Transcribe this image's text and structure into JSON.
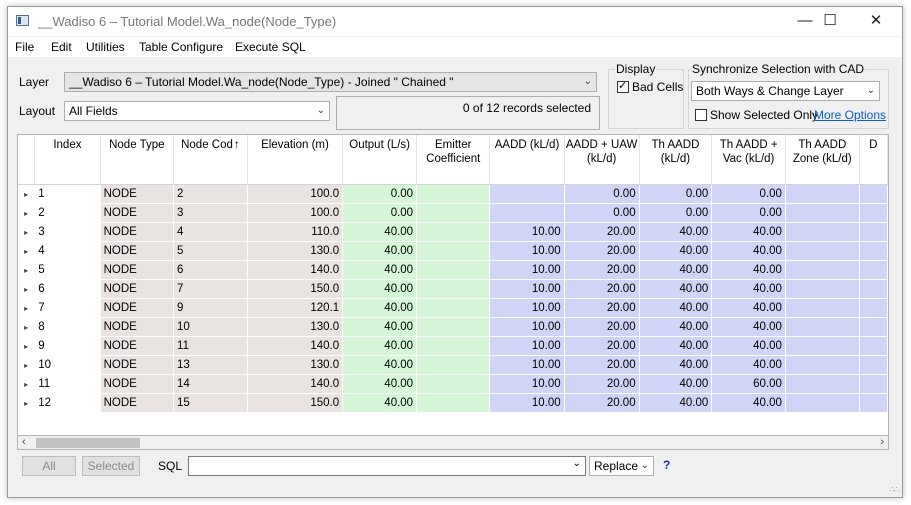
{
  "window": {
    "title": "__Wadiso 6 – Tutorial Model.Wa_node(Node_Type)",
    "controls": {
      "minimize": "—",
      "maximize": "☐",
      "close": "✕"
    }
  },
  "menu": [
    "File",
    "Edit",
    "Utilities",
    "Table Configure",
    "Execute SQL"
  ],
  "layer": {
    "label": "Layer",
    "value": "__Wadiso 6 – Tutorial Model.Wa_node(Node_Type) - Joined \" Chained \""
  },
  "layout": {
    "label": "Layout",
    "value": "All Fields"
  },
  "records": {
    "text": "0 of 12 records selected"
  },
  "display": {
    "title": "Display",
    "bad_cells_label": "Bad Cells",
    "bad_cells_checked": true
  },
  "sync": {
    "title": "Synchronize Selection with CAD",
    "value": "Both Ways & Change Layer",
    "show_selected_label": "Show Selected Only",
    "show_selected_checked": false,
    "more_options": "More Options"
  },
  "table": {
    "columns": [
      {
        "l1": "Index",
        "l2": ""
      },
      {
        "l1": "Node Type",
        "l2": ""
      },
      {
        "l1": "Node Cod",
        "l2": "",
        "sort_icon": "↑"
      },
      {
        "l1": "Elevation (m)",
        "l2": ""
      },
      {
        "l1": "Output (L/s)",
        "l2": ""
      },
      {
        "l1": "Emitter",
        "l2": "Coefficient"
      },
      {
        "l1": "AADD (kL/d)",
        "l2": ""
      },
      {
        "l1": "AADD + UAW",
        "l2": "(kL/d)"
      },
      {
        "l1": "Th AADD",
        "l2": "(kL/d)"
      },
      {
        "l1": "Th AADD +",
        "l2": "Vac (kL/d)"
      },
      {
        "l1": "Th AADD",
        "l2": "Zone (kL/d)"
      },
      {
        "l1": "D",
        "l2": ""
      }
    ],
    "rows": [
      [
        "1",
        "NODE",
        "2",
        "100.0",
        "0.00",
        "",
        "",
        "0.00",
        "0.00",
        "0.00",
        "",
        ""
      ],
      [
        "2",
        "NODE",
        "3",
        "100.0",
        "0.00",
        "",
        "",
        "0.00",
        "0.00",
        "0.00",
        "",
        ""
      ],
      [
        "3",
        "NODE",
        "4",
        "110.0",
        "40.00",
        "",
        "10.00",
        "20.00",
        "40.00",
        "40.00",
        "",
        ""
      ],
      [
        "4",
        "NODE",
        "5",
        "130.0",
        "40.00",
        "",
        "10.00",
        "20.00",
        "40.00",
        "40.00",
        "",
        ""
      ],
      [
        "5",
        "NODE",
        "6",
        "140.0",
        "40.00",
        "",
        "10.00",
        "20.00",
        "40.00",
        "40.00",
        "",
        ""
      ],
      [
        "6",
        "NODE",
        "7",
        "150.0",
        "40.00",
        "",
        "10.00",
        "20.00",
        "40.00",
        "40.00",
        "",
        ""
      ],
      [
        "7",
        "NODE",
        "9",
        "120.1",
        "40.00",
        "",
        "10.00",
        "20.00",
        "40.00",
        "40.00",
        "",
        ""
      ],
      [
        "8",
        "NODE",
        "10",
        "130.0",
        "40.00",
        "",
        "10.00",
        "20.00",
        "40.00",
        "40.00",
        "",
        ""
      ],
      [
        "9",
        "NODE",
        "11",
        "140.0",
        "40.00",
        "",
        "10.00",
        "20.00",
        "40.00",
        "40.00",
        "",
        ""
      ],
      [
        "10",
        "NODE",
        "13",
        "130.0",
        "40.00",
        "",
        "10.00",
        "20.00",
        "40.00",
        "40.00",
        "",
        ""
      ],
      [
        "11",
        "NODE",
        "14",
        "140.0",
        "40.00",
        "",
        "10.00",
        "20.00",
        "40.00",
        "60.00",
        "",
        ""
      ],
      [
        "12",
        "NODE",
        "15",
        "150.0",
        "40.00",
        "",
        "10.00",
        "20.00",
        "40.00",
        "40.00",
        "",
        ""
      ]
    ],
    "row_marker": "▸"
  },
  "colors": {
    "grey_cell": "#e9e3e1",
    "green_cell": "#d5f7d8",
    "blue_cell": "#d0d4f7",
    "link": "#0b5cc4"
  },
  "footer": {
    "all_label": "All",
    "selected_label": "Selected",
    "sql_label": "SQL",
    "sql_value": "",
    "replace_value": "Replace",
    "help_label": "?"
  }
}
